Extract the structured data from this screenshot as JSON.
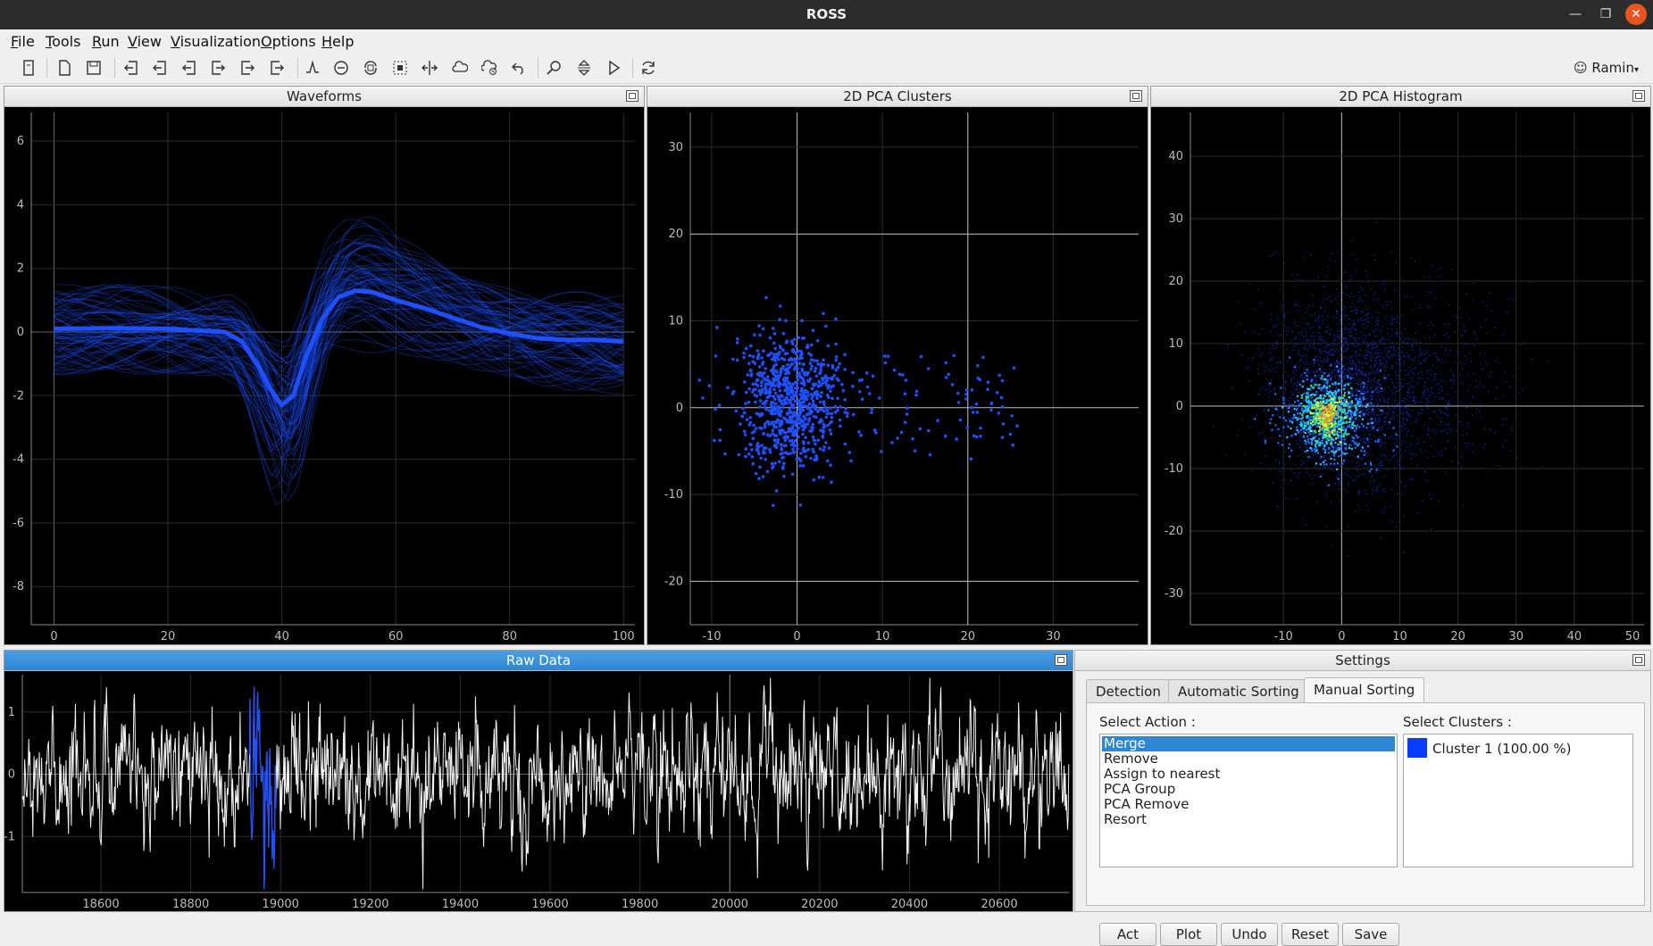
{
  "window": {
    "title": "ROSS"
  },
  "menu": [
    {
      "first": "F",
      "rest": "ile"
    },
    {
      "first": "T",
      "rest": "ools"
    },
    {
      "first": "R",
      "rest": "un"
    },
    {
      "first": "V",
      "rest": "iew"
    },
    {
      "first": "V",
      "rest": "isualization"
    },
    {
      "first": "O",
      "rest": "ptions"
    },
    {
      "first": "H",
      "rest": "elp"
    }
  ],
  "toolbar": {
    "user": "Ramin"
  },
  "panels": {
    "waveforms": "Waveforms",
    "pca_clusters": "2D PCA Clusters",
    "pca_histogram": "2D PCA Histogram",
    "raw_data": "Raw Data",
    "settings": "Settings"
  },
  "colors": {
    "cluster": "#1e50ff",
    "accent": "#2f86d3",
    "close": "#e95420"
  },
  "settings": {
    "tabs": [
      "Detection",
      "Automatic Sorting",
      "Manual Sorting"
    ],
    "selected_tab": "Manual Sorting",
    "select_action_label": "Select Action :",
    "select_clusters_label": "Select Clusters :",
    "actions": [
      "Merge",
      "Remove",
      "Assign to nearest",
      "PCA Group",
      "PCA Remove",
      "Resort"
    ],
    "selected_action": "Merge",
    "clusters": [
      "Cluster 1 (100.00 %)"
    ],
    "buttons": {
      "act": "Act",
      "plot": "Plot",
      "undo": "Undo",
      "reset": "Reset",
      "save": "Save"
    }
  },
  "chart_data": [
    {
      "type": "line",
      "name": "waveforms",
      "x_ticks": [
        0,
        20,
        40,
        60,
        80,
        100
      ],
      "y_ticks": [
        -8,
        -6,
        -4,
        -2,
        0,
        2,
        4,
        6
      ],
      "xlim": [
        -4,
        102
      ],
      "ylim": [
        -9.2,
        6.9
      ],
      "mean_waveform": {
        "x": [
          0,
          10,
          20,
          25,
          30,
          33,
          36,
          38,
          40,
          42,
          44,
          47,
          50,
          53,
          56,
          60,
          65,
          70,
          75,
          80,
          85,
          90,
          95,
          100
        ],
        "y": [
          0.1,
          0.12,
          0.1,
          0.05,
          0.0,
          -0.3,
          -1.1,
          -1.8,
          -2.3,
          -2.0,
          -0.9,
          0.4,
          1.1,
          1.3,
          1.25,
          1.0,
          0.75,
          0.45,
          0.15,
          -0.05,
          -0.2,
          -0.25,
          -0.25,
          -0.3
        ]
      }
    },
    {
      "type": "scatter",
      "name": "pca_clusters",
      "x_ticks": [
        -10,
        0,
        10,
        20,
        30
      ],
      "y_ticks": [
        -20,
        -10,
        0,
        10,
        20,
        30
      ],
      "xlim": [
        -12.5,
        40
      ],
      "ylim": [
        -25,
        34
      ]
    },
    {
      "type": "heatmap",
      "name": "pca_histogram",
      "x_ticks": [
        -10,
        0,
        10,
        20,
        30,
        40,
        50
      ],
      "y_ticks": [
        -30,
        -20,
        -10,
        0,
        10,
        20,
        30,
        40
      ],
      "xlim": [
        -26,
        52
      ],
      "ylim": [
        -35,
        47
      ]
    },
    {
      "type": "line",
      "name": "raw_data",
      "x_ticks": [
        18600,
        18800,
        19000,
        19200,
        19400,
        19600,
        19800,
        20000,
        20200,
        20400,
        20600
      ],
      "y_ticks": [
        -1,
        0,
        1
      ],
      "xlim": [
        18425,
        20755
      ],
      "ylim": [
        -1.9,
        1.6
      ],
      "highlight_range": [
        18930,
        18990
      ]
    }
  ]
}
